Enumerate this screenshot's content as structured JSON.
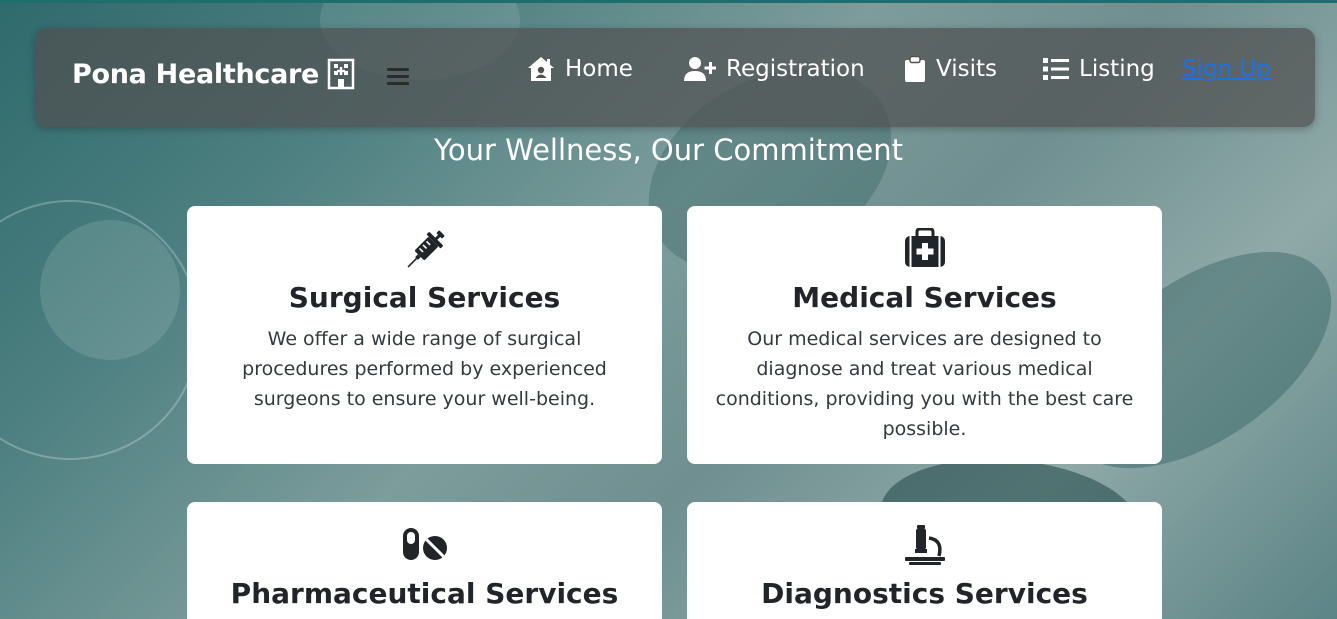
{
  "brand": {
    "name": "Pona Healthcare"
  },
  "nav": {
    "items": [
      {
        "label": "Home",
        "icon": "home-icon"
      },
      {
        "label": "Registration",
        "icon": "user-plus-icon"
      },
      {
        "label": "Visits",
        "icon": "clipboard-icon"
      },
      {
        "label": "Listing",
        "icon": "list-icon"
      }
    ],
    "signup_label": "Sign Up"
  },
  "tagline": "Your Wellness, Our Commitment",
  "services": [
    {
      "title": "Surgical Services",
      "icon": "syringe-icon",
      "description": "We offer a wide range of surgical procedures performed by experienced surgeons to ensure your well-being."
    },
    {
      "title": "Medical Services",
      "icon": "medical-kit-icon",
      "description": "Our medical services are designed to diagnose and treat various medical conditions, providing you with the best care possible."
    },
    {
      "title": "Pharmaceutical Services",
      "icon": "pills-icon",
      "description": ""
    },
    {
      "title": "Diagnostics Services",
      "icon": "microscope-icon",
      "description": ""
    }
  ],
  "colors": {
    "navbar_bg": "#505050",
    "link": "#1a73e8",
    "card_bg": "#ffffff",
    "text_dark": "#212529"
  }
}
